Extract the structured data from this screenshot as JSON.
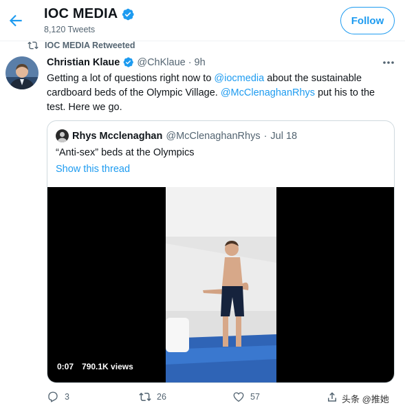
{
  "header": {
    "title": "IOC MEDIA",
    "tweet_count": "8,120 Tweets",
    "follow_label": "Follow"
  },
  "retweet": {
    "label": "IOC MEDIA Retweeted"
  },
  "tweet": {
    "author_name": "Christian Klaue",
    "author_handle": "@ChKlaue",
    "dot": "·",
    "time": "9h",
    "text_1": "Getting a lot of questions right now to ",
    "mention_1": "@iocmedia",
    "text_2": " about the sustainable cardboard beds of the Olympic Village. ",
    "mention_2": "@McClenaghanRhys",
    "text_3": " put his to the test. Here we go."
  },
  "quote": {
    "author_name": "Rhys Mcclenaghan",
    "author_handle": "@McClenaghanRhys",
    "dot": "·",
    "date": "Jul 18",
    "text": "“Anti-sex” beds at the Olympics",
    "thread_link": "Show this thread",
    "video_time": "0:07",
    "video_views": "790.1K views"
  },
  "actions": {
    "replies": "3",
    "retweets": "26",
    "likes": "57"
  },
  "watermark": "头条 @推她",
  "colors": {
    "accent": "#1d9bf0",
    "secondary_text": "#536471",
    "border": "#cfd9de"
  }
}
